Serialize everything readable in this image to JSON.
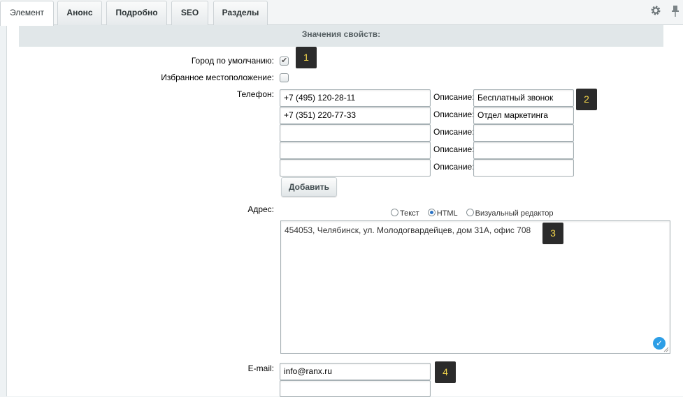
{
  "tabs": [
    {
      "label": "Элемент"
    },
    {
      "label": "Анонс"
    },
    {
      "label": "Подробно"
    },
    {
      "label": "SEO"
    },
    {
      "label": "Разделы"
    }
  ],
  "section_title": "Значения свойств:",
  "fields": {
    "default_city": {
      "label": "Город по умолчанию:",
      "checked": true
    },
    "favorite_location": {
      "label": "Избранное местоположение:",
      "checked": false
    },
    "phone": {
      "label": "Телефон:",
      "desc_label": "Описание:",
      "rows": [
        {
          "value": "+7 (495) 120-28-11",
          "description": "Бесплатный звонок"
        },
        {
          "value": "+7 (351) 220-77-33",
          "description": "Отдел маркетинга"
        },
        {
          "value": "",
          "description": ""
        },
        {
          "value": "",
          "description": ""
        },
        {
          "value": "",
          "description": ""
        }
      ],
      "add_button": "Добавить"
    },
    "address": {
      "label": "Адрес:",
      "modes": [
        {
          "label": "Текст",
          "selected": false
        },
        {
          "label": "HTML",
          "selected": true
        },
        {
          "label": "Визуальный редактор",
          "selected": false
        }
      ],
      "value": "454053, Челябинск, ул. Молодогвардейцев, дом 31А, офис 708"
    },
    "email": {
      "label": "E-mail:",
      "values": [
        "info@ranx.ru",
        ""
      ]
    }
  },
  "badges": [
    "1",
    "2",
    "3",
    "4"
  ],
  "colors": {
    "badge_bg": "#2b2b2b",
    "badge_text": "#f3d54b",
    "accent": "#2d9ee6"
  }
}
